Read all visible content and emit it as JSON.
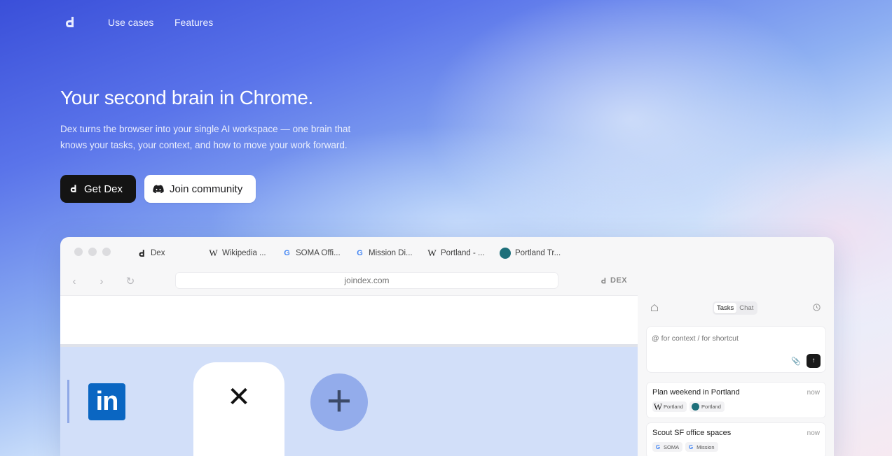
{
  "nav": {
    "links": [
      "Use cases",
      "Features"
    ]
  },
  "hero": {
    "title": "Your second brain in Chrome.",
    "subtitle": "Dex turns the browser into your single AI workspace — one brain that knows your tasks, your context, and how to move your work forward.",
    "primary_button": "Get Dex",
    "secondary_button": "Join community"
  },
  "browser": {
    "tabs": [
      {
        "label": "Dex",
        "icon": "dex-logo-icon"
      },
      {
        "label": "Wikipedia ...",
        "icon": "wikipedia-icon"
      },
      {
        "label": "SOMA Offi...",
        "icon": "google-icon"
      },
      {
        "label": "Mission Di...",
        "icon": "google-icon"
      },
      {
        "label": "Portland - ...",
        "icon": "wikipedia-icon"
      },
      {
        "label": "Portland Tr...",
        "icon": "portland-travel-icon"
      }
    ],
    "address": "joindex.com",
    "extension_label": "DEX"
  },
  "panel": {
    "tabs": [
      "Tasks",
      "Chat"
    ],
    "active_tab": "Tasks",
    "composer_placeholder": "@ for context / for shortcut",
    "tasks": [
      {
        "title": "Plan weekend in Portland",
        "time": "now",
        "chips": [
          "Portland",
          "Portland"
        ]
      },
      {
        "title": "Scout SF office spaces",
        "time": "now",
        "chips": [
          "SOMA",
          "Mission"
        ]
      }
    ]
  },
  "colors": {
    "primary_button": "#141414",
    "linkedin": "#0a66c2",
    "hero_gradient_start": "#3a4fd9"
  }
}
